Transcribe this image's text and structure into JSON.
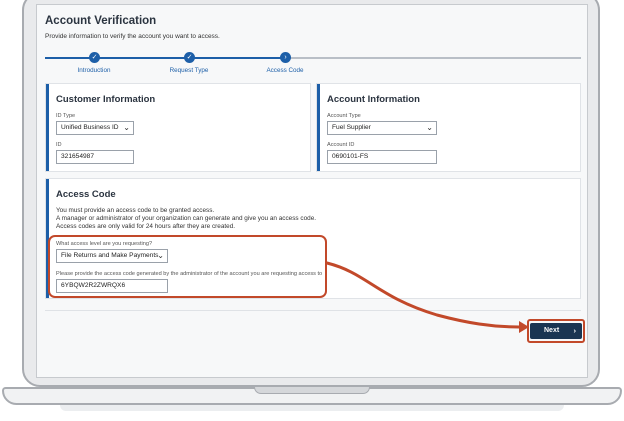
{
  "header": {
    "title": "Account Verification",
    "description": "Provide information to verify the account you want to access."
  },
  "stepper": {
    "steps": [
      {
        "label": "Introduction",
        "state": "completed",
        "icon": "check-icon"
      },
      {
        "label": "Request Type",
        "state": "completed",
        "icon": "check-icon"
      },
      {
        "label": "Access Code",
        "state": "current",
        "icon": "chevron-right-icon"
      }
    ]
  },
  "customer": {
    "title": "Customer Information",
    "id_type_label": "ID Type",
    "id_type_value": "Unified Business ID",
    "id_label": "ID",
    "id_value": "321654987"
  },
  "account": {
    "title": "Account Information",
    "type_label": "Account Type",
    "type_value": "Fuel Supplier",
    "id_label": "Account ID",
    "id_value": "0690101-FS"
  },
  "access": {
    "title": "Access Code",
    "line1": "You must provide an access code to be granted access.",
    "line2": "A manager or administrator of your organization can generate and give you an access code.",
    "line3": "Access codes are only valid for 24 hours after they are created.",
    "level_label": "What access level are you requesting?",
    "level_value": "File Returns and Make Payments",
    "code_label": "Please provide the access code generated by the administrator of the account you are requesting access to",
    "code_value": "6YBQW2R2ZWRQX6"
  },
  "footer": {
    "next_label": "Next",
    "next_icon": "chevron-right-icon"
  },
  "colors": {
    "primary": "#1d5fa8",
    "annotation": "#c2492a",
    "button_bg": "#1a3552"
  }
}
